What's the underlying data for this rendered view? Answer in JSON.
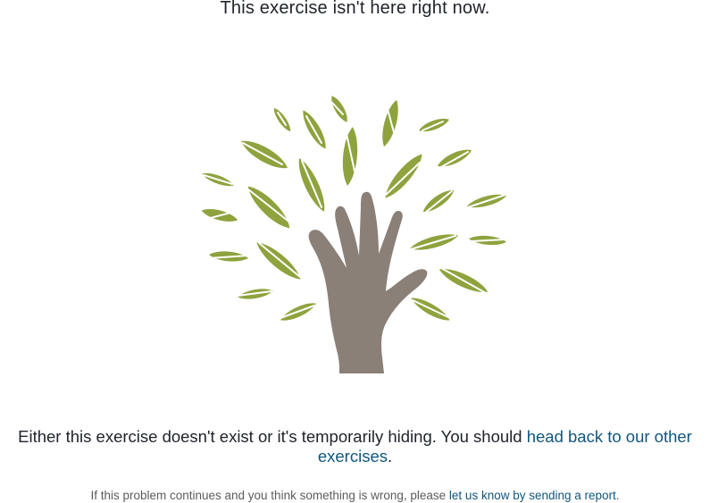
{
  "page": {
    "title": "This exercise isn't here right now."
  },
  "illustration": {
    "icon": "tree-hand-icon",
    "leaf_color": "#8ea33e",
    "hand_color": "#8a8078"
  },
  "message": {
    "text_before": "Either this exercise doesn't exist or it's temporarily hiding. You should ",
    "link_text": "head back to our other exercises",
    "text_after": "."
  },
  "footer": {
    "text_before": "If this problem continues and you think something is wrong, please ",
    "link_text": "let us know by sending a report",
    "text_after": "."
  },
  "colors": {
    "link": "#11567d",
    "text": "#21242c",
    "muted": "#5c5c5c"
  }
}
